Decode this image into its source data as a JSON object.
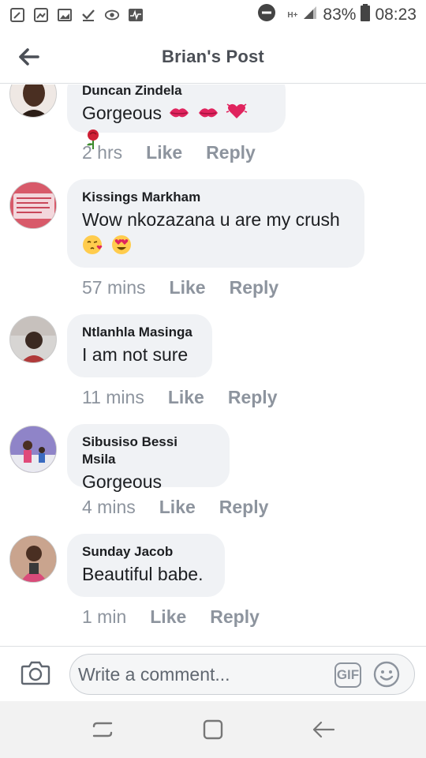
{
  "status_bar": {
    "network": "H+",
    "battery": "83%",
    "time": "08:23"
  },
  "header": {
    "title": "Brian's Post"
  },
  "comments": [
    {
      "author": "Duncan Zindela",
      "text": "Gorgeous",
      "emojis": [
        "kiss-mark",
        "kiss-mark",
        "beating-heart",
        "rose"
      ],
      "time": "2 hrs",
      "like": "Like",
      "reply": "Reply"
    },
    {
      "author": "Kissings Markham",
      "text": "Wow nkozazana u are my crush",
      "emojis": [
        "face-blowing-kiss",
        "heart-eyes"
      ],
      "time": "57 mins",
      "like": "Like",
      "reply": "Reply"
    },
    {
      "author": "Ntlanhla Masinga",
      "text": "I am not sure",
      "emojis": [],
      "time": "11 mins",
      "like": "Like",
      "reply": "Reply"
    },
    {
      "author": "Sibusiso Bessi Msila",
      "text": "Gorgeous",
      "emojis": [],
      "time": "4 mins",
      "like": "Like",
      "reply": "Reply"
    },
    {
      "author": "Sunday Jacob",
      "text": "Beautiful babe.",
      "emojis": [],
      "time": "1 min",
      "like": "Like",
      "reply": "Reply"
    }
  ],
  "composer": {
    "placeholder": "Write a comment...",
    "gif_label": "GIF"
  },
  "colors": {
    "bubble": "#f0f2f5",
    "meta_text": "#8d949e",
    "header_text": "#4b4f56"
  }
}
